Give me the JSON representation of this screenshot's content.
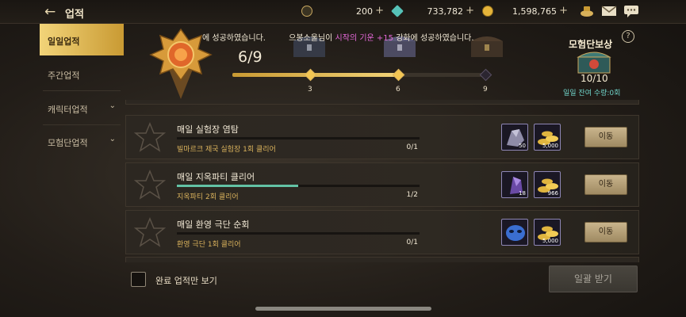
{
  "header": {
    "back_icon": "arrow-left-icon",
    "title": "업적",
    "currencies": [
      {
        "icon": "crown-coin-icon",
        "value": "200",
        "color": "#c9a860"
      },
      {
        "icon": "crystal-icon",
        "value": "733,782",
        "color": "#56c2b8"
      },
      {
        "icon": "gold-coin-icon",
        "value": "1,598,765",
        "color": "#e5b43a"
      }
    ],
    "add_label": "+",
    "icons": [
      "bag-icon",
      "mail-icon",
      "chat-icon"
    ]
  },
  "sidebar": {
    "tabs": [
      {
        "label": "일일업적",
        "active": true
      },
      {
        "label": "주간업적",
        "active": false
      },
      {
        "label": "캐릭터업적",
        "active": false,
        "expandable": true
      },
      {
        "label": "모험단업적",
        "active": false,
        "expandable": true
      }
    ]
  },
  "banner": {
    "notice_prefix": "에 성공하였습니다.",
    "notice_main": "으봉소울님이 ",
    "notice_item": "시작의 기운 +15",
    "notice_suffix": " 강화에 성공하였습니다.",
    "progress": "6/9",
    "progress_value": 6,
    "progress_max": 9,
    "milestones": [
      "3",
      "6",
      "9"
    ],
    "reward_title": "모험단보상",
    "help_label": "?",
    "reward_count": "10/10",
    "reward_remaining": "일일 잔여 수량:0회"
  },
  "achievements": [
    {
      "name": "매일 실험장 염탐",
      "desc": "빌마르크 제국 실험장 1회 클리어",
      "progress": "0/1",
      "progress_value": 0,
      "rewards": [
        {
          "icon": "ore-icon",
          "qty": "50",
          "color": "#8f8ca8"
        },
        {
          "icon": "gold-pile-icon",
          "qty": "5,000",
          "color": "#e0b53f"
        }
      ],
      "action": "이동"
    },
    {
      "name": "매일 지옥파티 클리어",
      "desc": "지옥파티 2회 클리어",
      "progress": "1/2",
      "progress_value": 0.5,
      "rewards": [
        {
          "icon": "dark-crystal-icon",
          "qty": "18",
          "color": "#6a4aa6"
        },
        {
          "icon": "gold-pile-icon",
          "qty": "966",
          "color": "#e0b53f"
        }
      ],
      "action": "이동"
    },
    {
      "name": "매일 환영 극단 순회",
      "desc": "환영 극단 1회 클리어",
      "progress": "0/1",
      "progress_value": 0,
      "rewards": [
        {
          "icon": "blue-mask-icon",
          "qty": "",
          "color": "#3a6ed0"
        },
        {
          "icon": "gold-pile-icon",
          "qty": "5,000",
          "color": "#e0b53f"
        }
      ],
      "action": "이동"
    }
  ],
  "footer": {
    "completed_only_label": "완료 업적만 보기",
    "claim_all_label": "일괄 받기"
  }
}
